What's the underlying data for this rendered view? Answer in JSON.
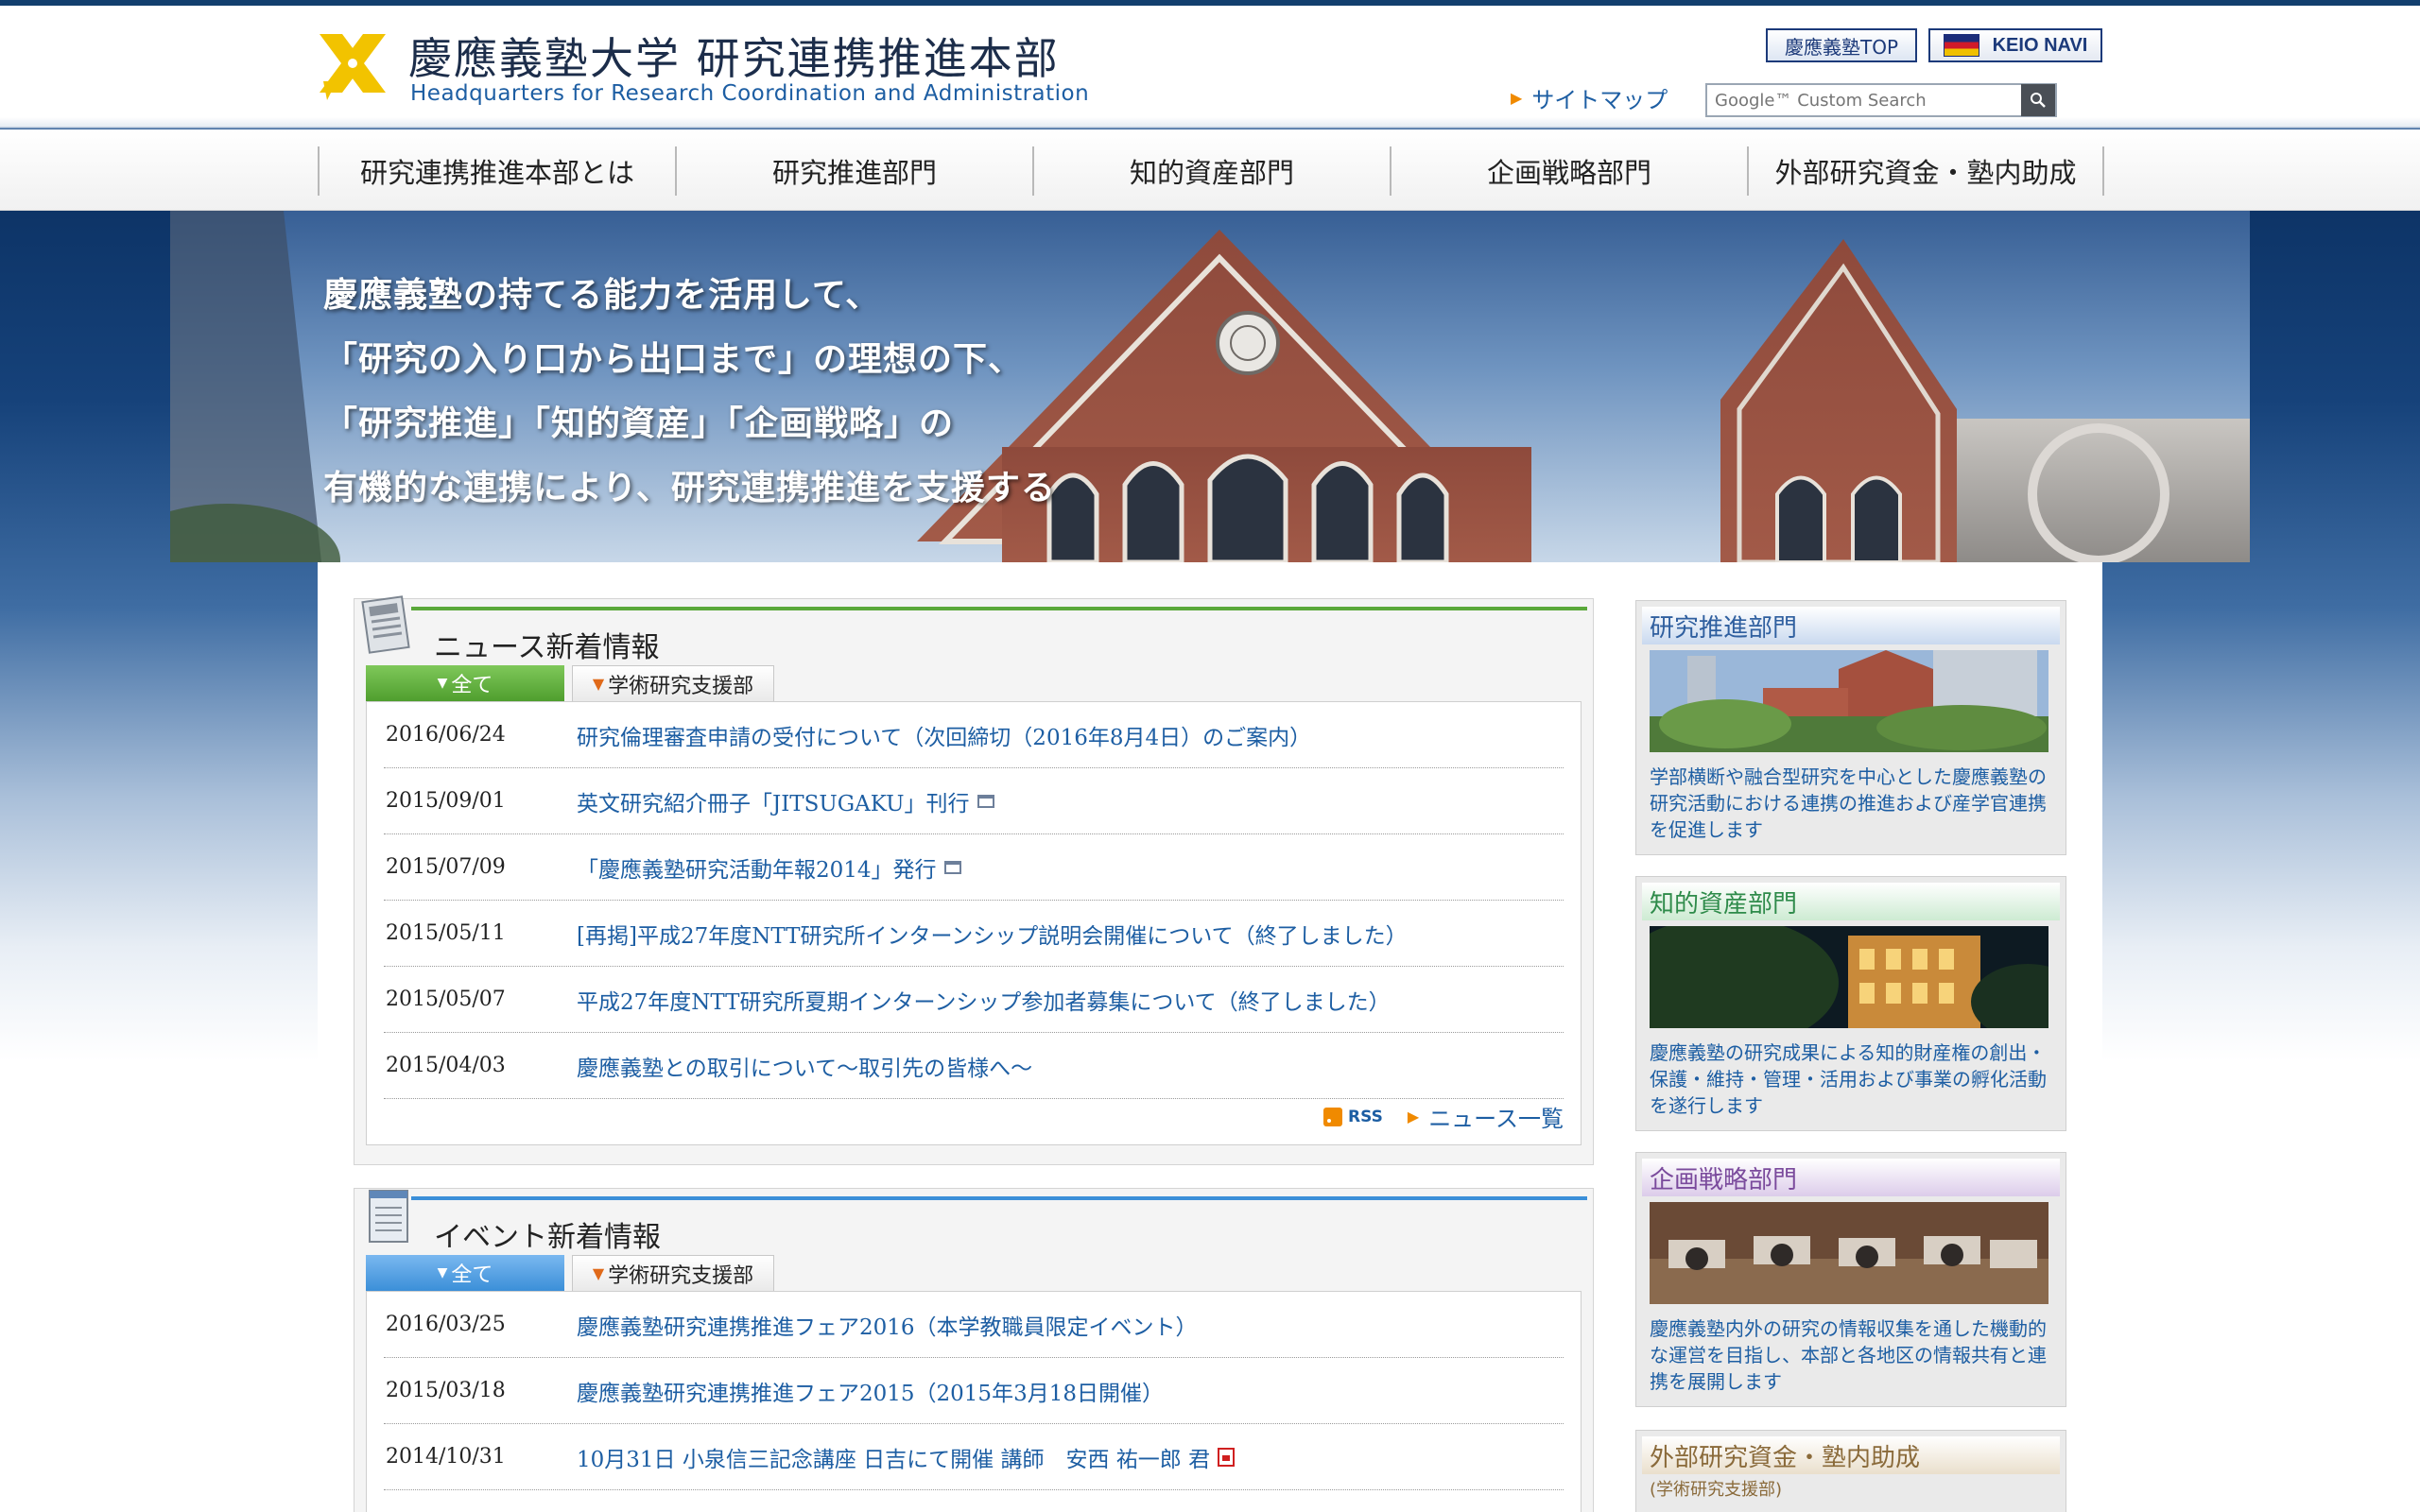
{
  "header": {
    "title_ja": "慶應義塾大学 研究連携推進本部",
    "title_en": "Headquarters for Research Coordination and Administration",
    "keio_top_label": "慶應義塾TOP",
    "keio_navi_label": "KEIO NAVI",
    "sitemap_label": "サイトマップ",
    "search_placeholder": "Google™ Custom Search"
  },
  "nav": {
    "items": [
      "研究連携推進本部とは",
      "研究推進部門",
      "知的資産部門",
      "企画戦略部門",
      "外部研究資金・塾内助成"
    ]
  },
  "hero": {
    "lines": [
      "慶應義塾の持てる能力を活用して、",
      "「研究の入り口から出口まで」の理想の下、",
      "「研究推進」「知的資産」「企画戦略」の",
      "有機的な連携により、研究連携推進を支援する"
    ]
  },
  "news": {
    "title": "ニュース新着情報",
    "tab_all": "全て",
    "tab_dept": "学術研究支援部",
    "items": [
      {
        "date": "2016/06/24",
        "title": "研究倫理審査申請の受付について（次回締切（2016年8月4日）のご案内）",
        "icon": "none"
      },
      {
        "date": "2015/09/01",
        "title": "英文研究紹介冊子「JITSUGAKU」刊行",
        "icon": "window-icon"
      },
      {
        "date": "2015/07/09",
        "title": "「慶應義塾研究活動年報2014」発行",
        "icon": "window-icon"
      },
      {
        "date": "2015/05/11",
        "title": "[再掲]平成27年度NTT研究所インターンシップ説明会開催について（終了しました）",
        "icon": "none"
      },
      {
        "date": "2015/05/07",
        "title": "平成27年度NTT研究所夏期インターンシップ参加者募集について（終了しました）",
        "icon": "none"
      },
      {
        "date": "2015/04/03",
        "title": "慶應義塾との取引について〜取引先の皆様へ〜",
        "icon": "none"
      }
    ],
    "rss_label": "RSS",
    "list_label": "ニュース一覧"
  },
  "events": {
    "title": "イベント新着情報",
    "tab_all": "全て",
    "tab_dept": "学術研究支援部",
    "items": [
      {
        "date": "2016/03/25",
        "title": "慶應義塾研究連携推進フェア2016（本学教職員限定イベント）",
        "icon": "none"
      },
      {
        "date": "2015/03/18",
        "title": "慶應義塾研究連携推進フェア2015（2015年3月18日開催）",
        "icon": "none"
      },
      {
        "date": "2014/10/31",
        "title": "10月31日 小泉信三記念講座 日吉にて開催 講師　安西 祐一郎 君",
        "icon": "pdf-icon"
      }
    ]
  },
  "sidebar": {
    "research": {
      "title": "研究推進部門",
      "text": "学部横断や融合型研究を中心とした慶應義塾の研究活動における連携の推進および産学官連携を促進します"
    },
    "ip": {
      "title": "知的資産部門",
      "text": "慶應義塾の研究成果による知的財産権の創出・保護・維持・管理・活用および事業の孵化活動を遂行します"
    },
    "planning": {
      "title": "企画戦略部門",
      "text": "慶應義塾内外の研究の情報収集を通した機動的な運営を目指し、本部と各地区の情報共有と連携を展開します"
    },
    "funding": {
      "title": "外部研究資金・塾内助成",
      "subtitle": "(学術研究支援部)"
    }
  },
  "colors": {
    "navy": "#123f6e",
    "link_blue": "#1d5ea3",
    "news_green": "#5aa83a",
    "event_blue": "#3b8fd8",
    "accent_orange": "#f08a00"
  }
}
